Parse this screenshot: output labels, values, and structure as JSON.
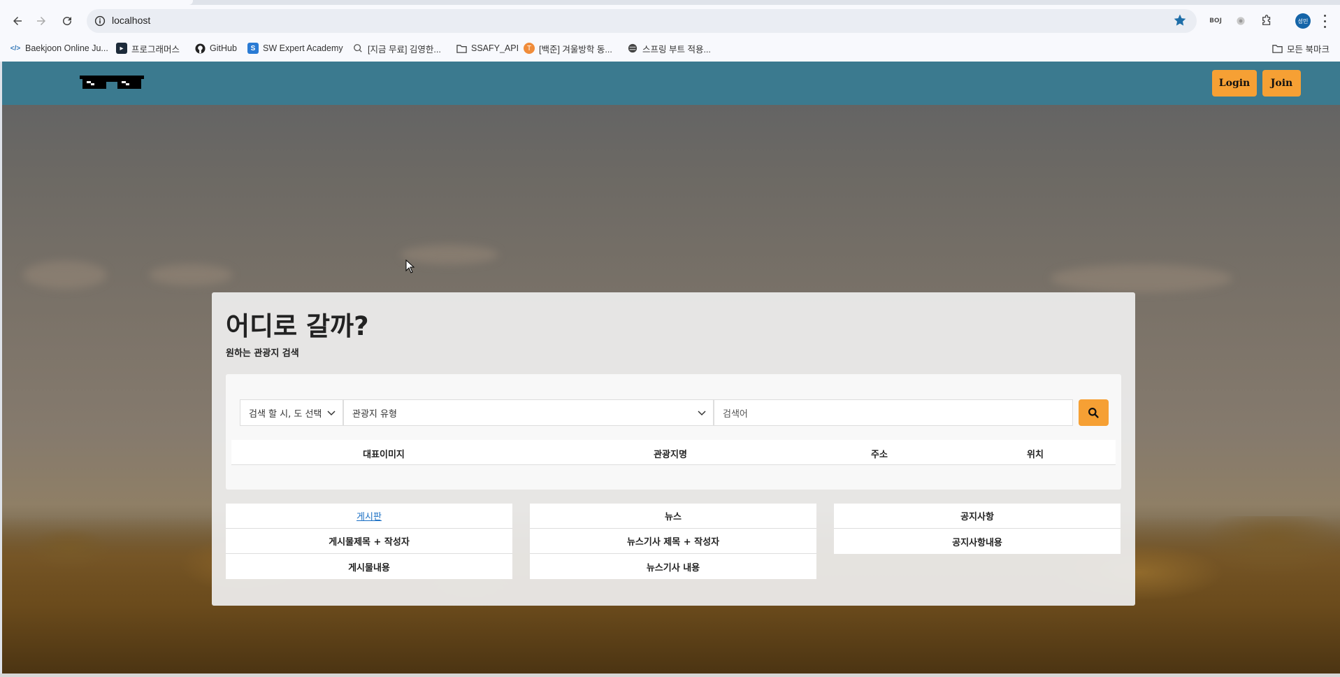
{
  "browser": {
    "url": "localhost",
    "bookmarks": [
      {
        "label": "Baekjoon Online Ju...",
        "icon": "code-icon"
      },
      {
        "label": "프로그래머스",
        "icon": "programmers-icon"
      },
      {
        "label": "GitHub",
        "icon": "github-icon"
      },
      {
        "label": "SW Expert Academy",
        "icon": "swea-icon"
      },
      {
        "label": "[지금 무료] 김영한...",
        "icon": "inflearn-icon"
      },
      {
        "label": "SSAFY_API",
        "icon": "folder-icon"
      },
      {
        "label": "[백준] 겨울방학 동...",
        "icon": "notion-icon"
      },
      {
        "label": "스프링 부트 적용...",
        "icon": "globe-icon"
      }
    ],
    "all_bookmarks": "모든 북마크",
    "profile_initials": "성민",
    "ext_label": "BOJ"
  },
  "nav": {
    "login": "Login",
    "join": "Join"
  },
  "hero": {
    "title": "어디로 갈까?",
    "subtitle": "원하는 관광지 검색"
  },
  "search": {
    "region_select": "검색 할 시, 도 선택",
    "type_select": "관광지 유형",
    "keyword_placeholder": "검색어"
  },
  "results": {
    "headers": [
      "대표이미지",
      "관광지명",
      "주소",
      "위치"
    ]
  },
  "cards": {
    "board": [
      "게시판",
      "게시물제목 + 작성자",
      "게시물내용"
    ],
    "news": [
      "뉴스",
      "뉴스기사 제목 + 작성자",
      "뉴스기사 내용"
    ],
    "notice": [
      "공지사항",
      "공지사항내용"
    ]
  },
  "colors": {
    "nav_bg": "#3b7a8f",
    "accent": "#f6a034",
    "link": "#1a6fc4"
  }
}
